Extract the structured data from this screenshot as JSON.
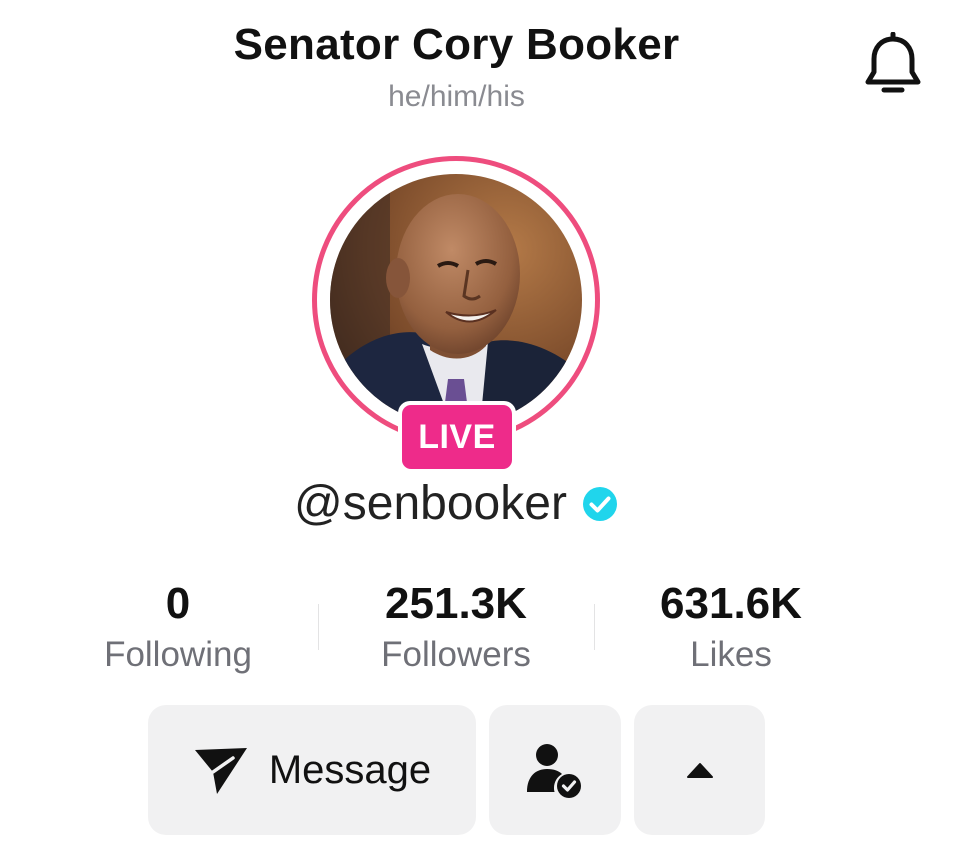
{
  "header": {
    "title": "Senator Cory Booker",
    "pronouns": "he/him/his",
    "bell_icon": "bell-icon"
  },
  "profile": {
    "avatar_description_icon": "profile-photo",
    "live_label": "LIVE",
    "username": "@senbooker",
    "verified_icon": "verified-badge-icon",
    "ring_color": "#ee4d7e",
    "live_color": "#ee2b8a",
    "verified_color": "#20d5ec"
  },
  "stats": [
    {
      "value": "0",
      "label": "Following"
    },
    {
      "value": "251.3K",
      "label": "Followers"
    },
    {
      "value": "631.6K",
      "label": "Likes"
    }
  ],
  "actions": {
    "message_label": "Message",
    "message_icon": "send-icon",
    "friends_icon": "user-check-icon",
    "more_icon": "caret-up-icon"
  }
}
